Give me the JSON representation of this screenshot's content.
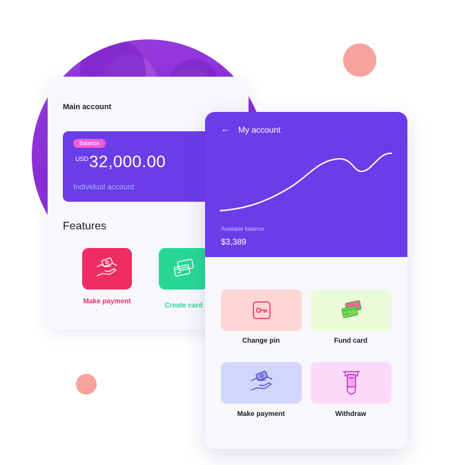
{
  "main_card": {
    "title": "Main account",
    "balance": {
      "badge": "Balance",
      "currency": "USD",
      "amount": "32,000.00",
      "account_type": "Individual account"
    },
    "features_title": "Features",
    "features": [
      {
        "label": "Make payment",
        "icon": "hand-money-icon",
        "color": "#ee2d63"
      },
      {
        "label": "Create card",
        "icon": "cards-icon",
        "color": "#27d895"
      }
    ]
  },
  "account_card": {
    "title": "My account",
    "back_icon": "arrow-left-icon",
    "available_label": "Available balance",
    "available_value": "$3,389",
    "actions": [
      {
        "label": "Change pin",
        "icon": "key-icon",
        "color": "#ffd5d5"
      },
      {
        "label": "Fund card",
        "icon": "cards-icon",
        "color": "#ebfad9"
      },
      {
        "label": "Make payment",
        "icon": "hand-money-icon",
        "color": "#d3d5fb"
      },
      {
        "label": "Withdraw",
        "icon": "atm-withdraw-icon",
        "color": "#fcd8fb"
      }
    ]
  },
  "colors": {
    "primary": "#6a3de8",
    "badge": "#f25bd8",
    "accent_coral": "#f8a29e"
  }
}
